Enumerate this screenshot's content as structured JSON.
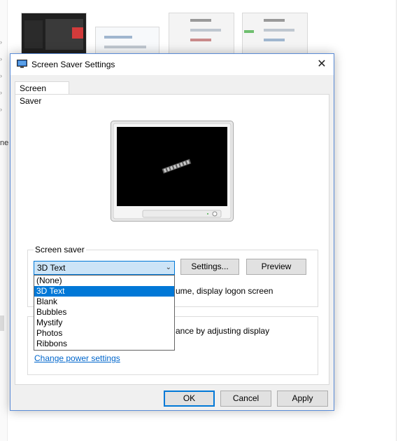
{
  "dialog": {
    "title": "Screen Saver Settings",
    "close_glyph": "✕",
    "tab_label": "Screen Saver",
    "screensaver_group_label": "Screen saver",
    "selected_screensaver": "3D Text",
    "settings_button": "Settings...",
    "preview_button": "Preview",
    "resume_text_partial": "ume, display logon screen",
    "power_text_partial": "ance by adjusting display",
    "power_link": "Change power settings",
    "ok_button": "OK",
    "cancel_button": "Cancel",
    "apply_button": "Apply"
  },
  "dropdown": {
    "options": [
      "(None)",
      "3D Text",
      "Blank",
      "Bubbles",
      "Mystify",
      "Photos",
      "Ribbons"
    ],
    "highlighted": "3D Text"
  },
  "background": {
    "partial_text": "ne"
  },
  "colors": {
    "accent": "#0078d7",
    "link": "#0066cc",
    "combo_bg": "#cce4f7"
  }
}
